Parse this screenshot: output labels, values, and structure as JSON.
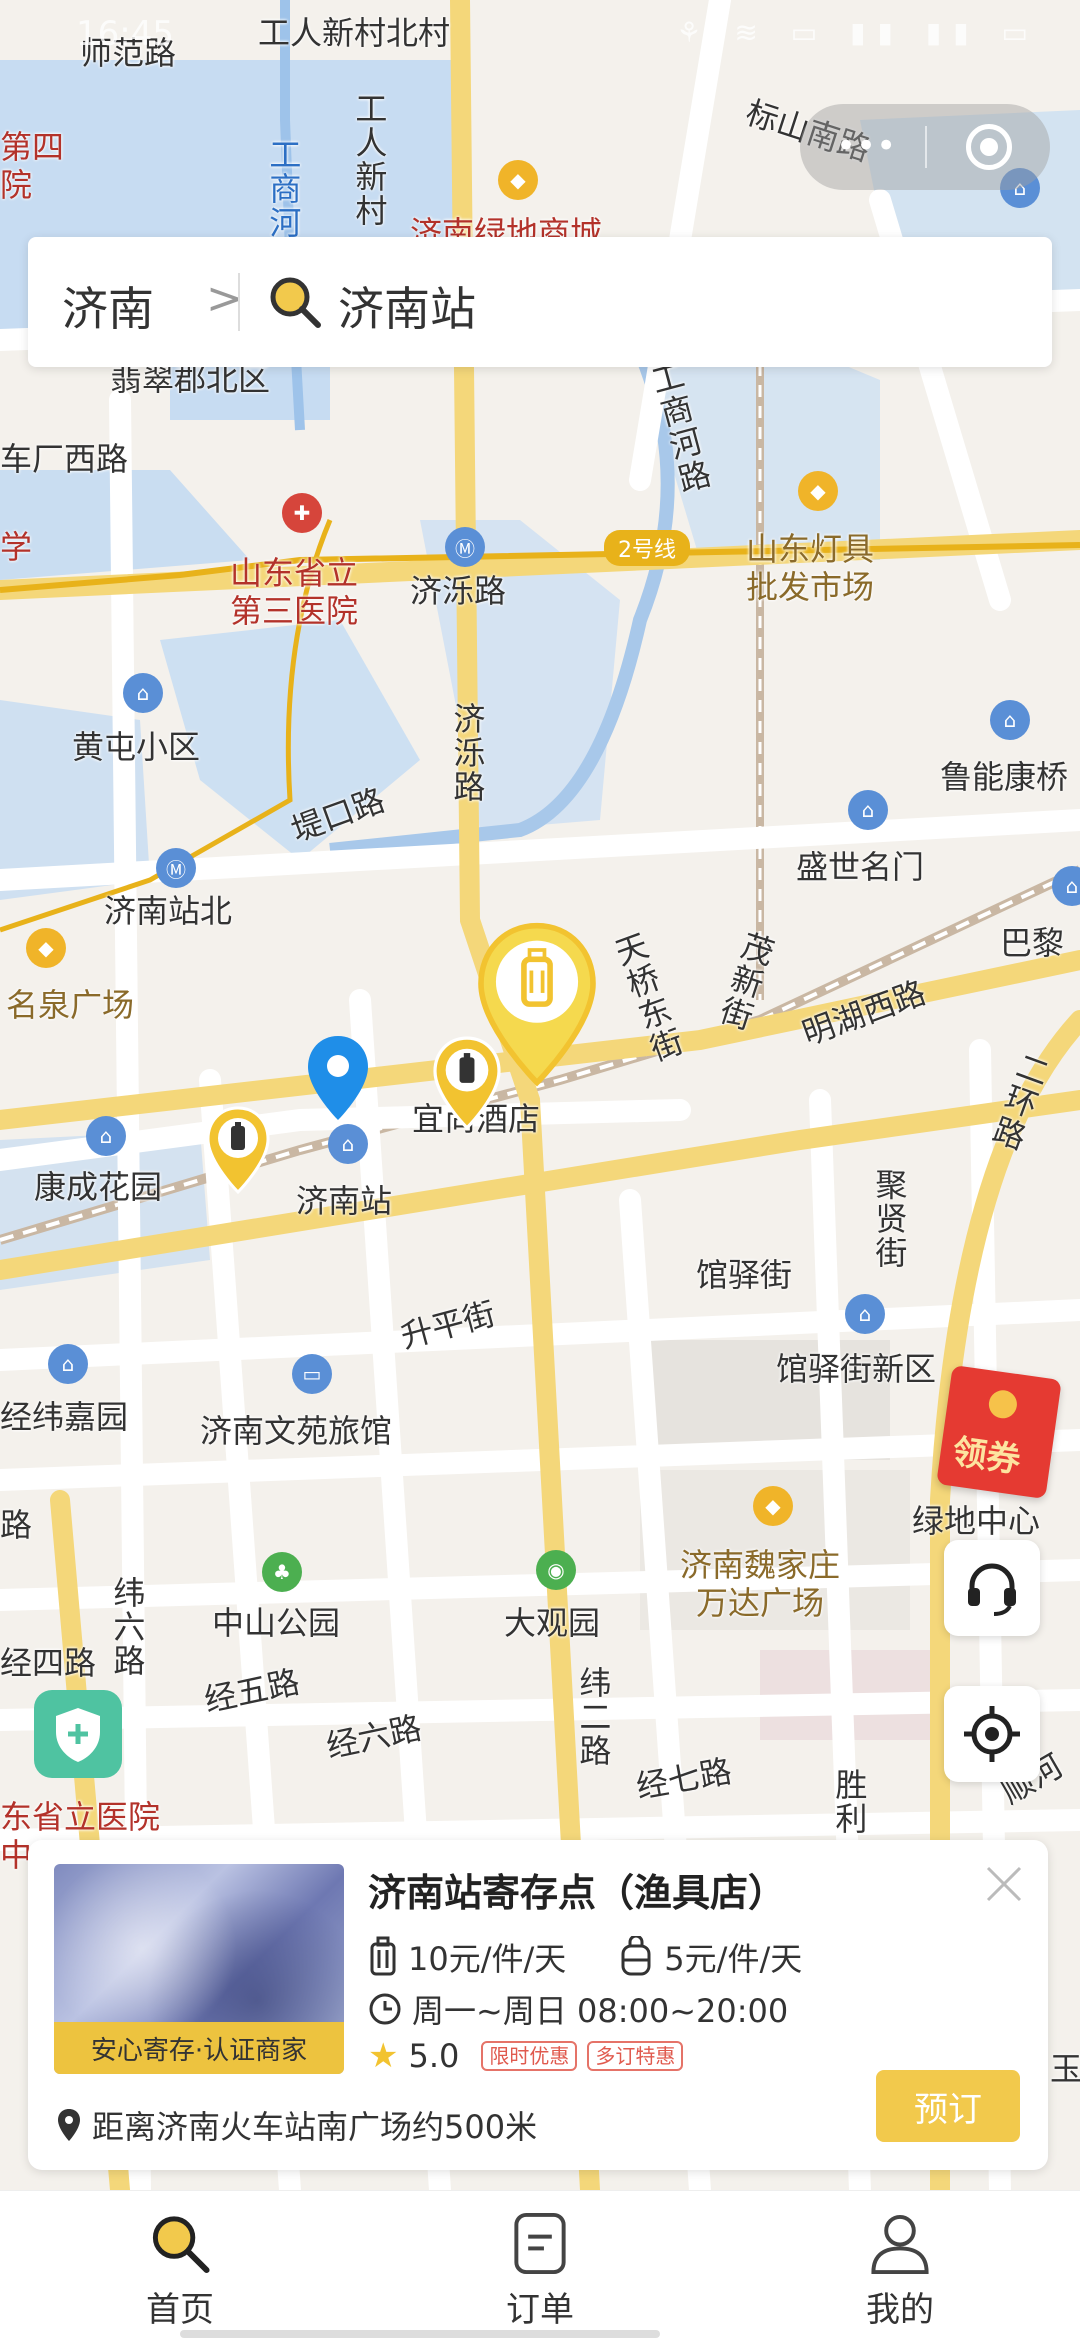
{
  "status": {
    "time": "16:45"
  },
  "search": {
    "city": "济南",
    "chevron": ">",
    "query": "济南站"
  },
  "map": {
    "labels": {
      "shifan_road": "师范路",
      "gongren_xincun_north": "工人新村北村",
      "gongren_xincun_v": "工人新村",
      "gongshang_he": "工商河",
      "di_si": "第四",
      "yuan": "院",
      "biaoshan_south": "标山南路",
      "lvdi_mall": "济南绿地商城",
      "cuipingjun_north": "翡翠郡北区",
      "chechang_west": "车厂西路",
      "xue": "学",
      "shandong_third_hospital": "山东省立\n第三医院",
      "jiluo_road": "济泺路",
      "line2": "2号线",
      "shandong_lighting": "山东灯具\n批发市场",
      "gongshang_he_road": "工商河路",
      "huangtun": "黄屯小区",
      "jiluo_road_v": "济泺路",
      "tikou_road": "堤口路",
      "lunengkang": "鲁能康桥",
      "jinan_station_north": "济南站北",
      "shengshi_mingmen": "盛世名门",
      "mingquan_square": "名泉广场",
      "tianqiao": "天桥东街",
      "maoxin_street": "茂新街",
      "mingquan_west": "明湖西路",
      "bali": "巴黎",
      "yifa_hotel": "宜尚酒店",
      "kangcheng": "康成花园",
      "jinan_station": "济南站",
      "guanyi_street": "馆驿街",
      "jiaxian_street": "聚贤街",
      "shengping_street": "升平街",
      "guanyi_new": "馆驿街新区",
      "jingwei_jiayuan": "经纬嘉园",
      "wenyuan_hotel": "济南文苑旅馆",
      "lvdi_center": "绿地中心",
      "lu": "路",
      "weijia_wanda": "济南魏家庄\n万达广场",
      "wei_liu": "纬六路",
      "zhongshan_park": "中山公园",
      "daguan_yuan": "大观园",
      "jing_si": "经四路",
      "jing_wu": "经五路",
      "wei_er": "纬二路",
      "jing_liu": "经六路",
      "jing_qi": "经七路",
      "sheng_li": "胜利",
      "shun_he": "顺河",
      "shandong_provincial": "东省立医院",
      "zhong": "中",
      "er_huan_east": "二环路",
      "yu": "玉"
    }
  },
  "coupon": {
    "label": "领券"
  },
  "card": {
    "store_name": "济南站寄存点（渔具店）",
    "badge": "安心寄存·认证商家",
    "price_luggage": "10元/件/天",
    "price_bag": "5元/件/天",
    "hours": "周一~周日 08:00~20:00",
    "rating": "5.0",
    "tags": [
      "限时优惠",
      "多订特惠"
    ],
    "distance": "距离济南火车站南广场约500米",
    "book_label": "预订"
  },
  "tabs": [
    {
      "label": "首页",
      "icon": "search-icon",
      "active": true
    },
    {
      "label": "订单",
      "icon": "order-icon",
      "active": false
    },
    {
      "label": "我的",
      "icon": "user-icon",
      "active": false
    }
  ],
  "colors": {
    "accent": "#f2c94c",
    "marker": "#f2c330",
    "tag": "#e05a4e"
  }
}
